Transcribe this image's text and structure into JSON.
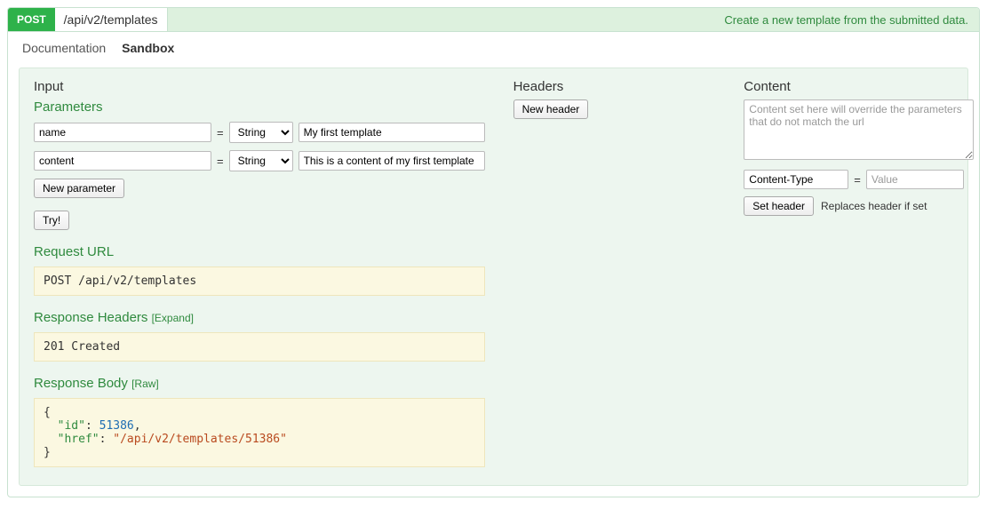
{
  "header": {
    "method": "POST",
    "path": "/api/v2/templates",
    "description": "Create a new template from the submitted data."
  },
  "tabs": {
    "documentation": "Documentation",
    "sandbox": "Sandbox"
  },
  "input": {
    "title": "Input",
    "parameters_title": "Parameters",
    "params": [
      {
        "name": "name",
        "type": "String",
        "value": "My first template"
      },
      {
        "name": "content",
        "type": "String",
        "value": "This is a content of my first template"
      }
    ],
    "type_options": [
      "String"
    ],
    "new_parameter_label": "New parameter",
    "try_label": "Try!"
  },
  "headers": {
    "title": "Headers",
    "new_header_label": "New header"
  },
  "content": {
    "title": "Content",
    "placeholder": "Content set here will override the parameters that do not match the url",
    "content_type_name": "Content-Type",
    "content_type_value_placeholder": "Value",
    "set_header_label": "Set header",
    "set_header_hint": "Replaces header if set"
  },
  "request_url": {
    "title": "Request URL",
    "text": "POST /api/v2/templates"
  },
  "response_headers": {
    "title": "Response Headers",
    "expand_label": "[Expand]",
    "text": "201 Created"
  },
  "response_body": {
    "title": "Response Body",
    "raw_label": "[Raw]",
    "json_lines": [
      "{",
      "  \"id\": 51386,",
      "  \"href\": \"/api/v2/templates/51386\"",
      "}"
    ]
  }
}
